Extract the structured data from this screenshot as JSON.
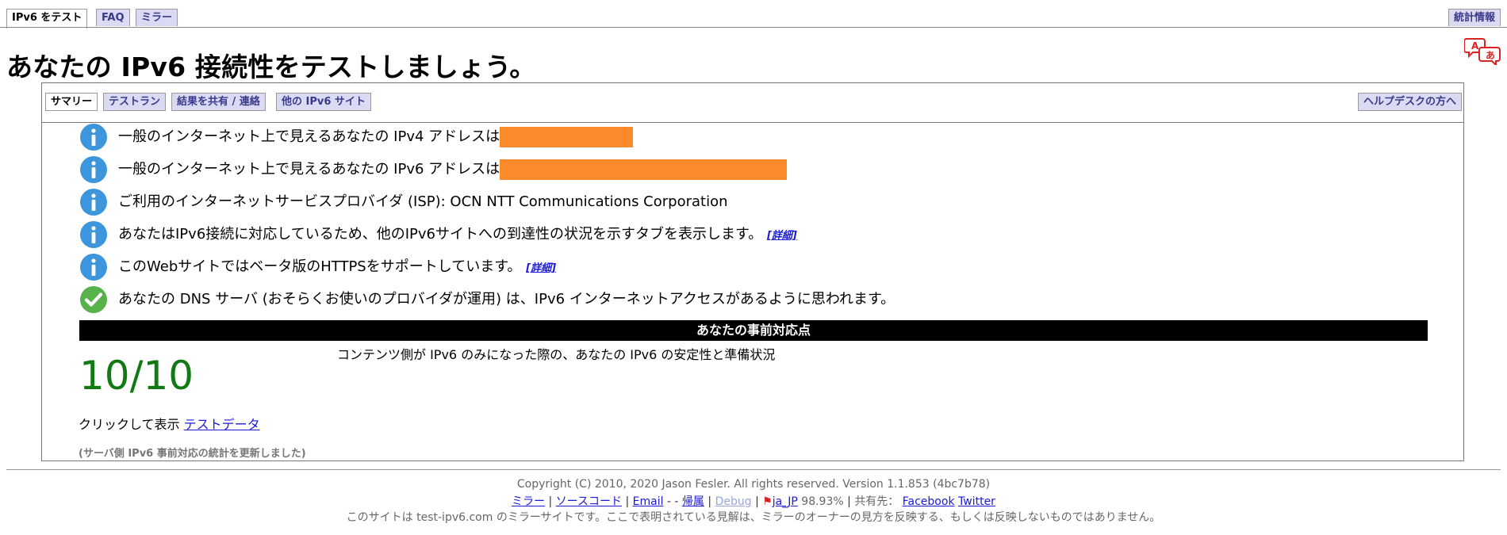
{
  "nav": {
    "tabs": [
      "IPv6 をテスト",
      "FAQ",
      "ミラー"
    ],
    "stats": "統計情報"
  },
  "page": {
    "title": "あなたの IPv6 接続性をテストしましょう。"
  },
  "subnav": {
    "tabs": [
      "サマリー",
      "テストラン",
      "結果を共有 / 連絡",
      "他の IPv6 サイト"
    ],
    "help": "ヘルプデスクの方へ"
  },
  "summary": {
    "rows": [
      {
        "icon": "info-icon",
        "text": "一般のインターネット上で見えるあなたの IPv4 アドレスは"
      },
      {
        "icon": "info-icon",
        "text": "一般のインターネット上で見えるあなたの IPv6 アドレスは"
      },
      {
        "icon": "info-icon",
        "text": "ご利用のインターネットサービスプロバイダ (ISP): OCN NTT Communications Corporation"
      },
      {
        "icon": "info-icon",
        "text": "あなたはIPv6接続に対応しているため、他のIPv6サイトへの到達性の状況を示すタブを表示します。",
        "link": "[詳細]"
      },
      {
        "icon": "info-icon",
        "text": "このWebサイトではベータ版のHTTPSをサポートしています。",
        "link": "[詳細]"
      },
      {
        "icon": "check-icon",
        "text": "あなたの DNS サーバ (おそらくお使いのプロバイダが運用) は、IPv6 インターネットアクセスがあるように思われます。"
      }
    ],
    "score_header": "あなたの事前対応点",
    "score": "10/10",
    "score_description": "コンテンツ側が IPv6 のみになった際の、あなたの IPv6 の安定性と準備状況",
    "click_prefix": "クリックして表示",
    "test_data_link": "テストデータ",
    "server_note": "(サーバ側 IPv6 事前対応の統計を更新しました)"
  },
  "footer": {
    "copyright": "Copyright (C) 2010, 2020 Jason Fesler. All rights reserved. Version 1.1.853 (4bc7b78)",
    "links": {
      "mirror": "ミラー",
      "source": "ソースコード",
      "email": "Email",
      "attribution": "帰属",
      "debug": "Debug",
      "locale": "ja_JP",
      "locale_pct": "98.93%",
      "share_label": "共有先：",
      "facebook": "Facebook",
      "twitter": "Twitter"
    },
    "disclaimer": "このサイトは test-ipv6.com のミラーサイトです。ここで表明されている見解は、ミラーのオーナーの見方を反映する、もしくは反映しないものではありません。"
  },
  "colors": {
    "redaction": "#fa8a2c",
    "score": "#127a12",
    "tab_bg": "#dadaf2",
    "link": "#1a1ad8"
  }
}
